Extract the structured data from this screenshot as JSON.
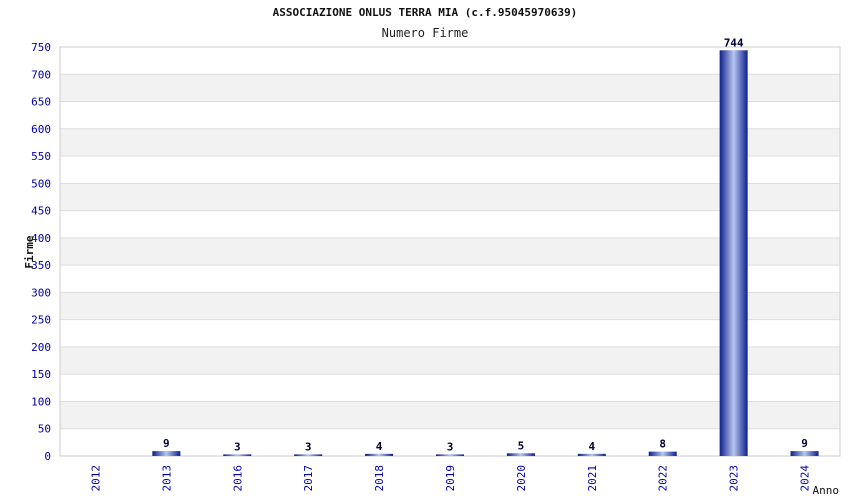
{
  "chart_data": {
    "type": "bar",
    "title": "ASSOCIAZIONE ONLUS TERRA MIA (c.f.95045970639)",
    "subtitle": "Numero Firme",
    "xlabel": "Anno",
    "ylabel": "Firme",
    "categories": [
      "2012",
      "2013",
      "2016",
      "2017",
      "2018",
      "2019",
      "2020",
      "2021",
      "2022",
      "2023",
      "2024"
    ],
    "values": [
      0,
      9,
      3,
      3,
      4,
      3,
      5,
      4,
      8,
      744,
      9
    ],
    "data_labels": [
      "",
      "9",
      "3",
      "3",
      "4",
      "3",
      "5",
      "4",
      "8",
      "744",
      "9"
    ],
    "ylim": [
      0,
      750
    ],
    "yticks": [
      "0",
      "50",
      "100",
      "150",
      "200",
      "250",
      "300",
      "350",
      "400",
      "450",
      "500",
      "550",
      "600",
      "650",
      "700",
      "750"
    ],
    "grid": "horizontal, alternating bands",
    "colors": {
      "bar_dark": "#0d1f8c",
      "bar_light": "#b8c6ee",
      "axis_tick_labels": "#0000aa",
      "data_labels": "#000033",
      "band": "#f2f2f2",
      "gridline": "#dddddd"
    }
  }
}
